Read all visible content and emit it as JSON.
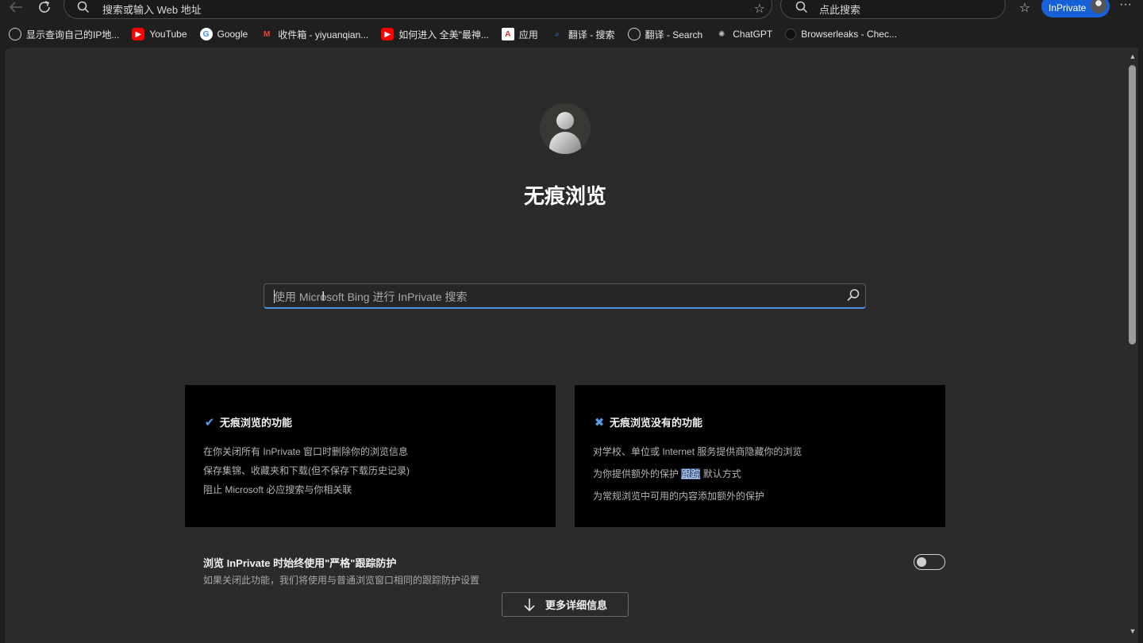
{
  "toolbar": {
    "address_text": "搜索或输入 Web 地址",
    "search_text": "点此搜索",
    "inprivate_label": "InPrivate"
  },
  "bookmarks": [
    {
      "label": "显示查询自己的IP地...",
      "icon": "globe-icon"
    },
    {
      "label": "YouTube",
      "icon": "youtube-icon"
    },
    {
      "label": "Google",
      "icon": "google-icon"
    },
    {
      "label": "收件箱 - yiyuanqian...",
      "icon": "gmail-icon"
    },
    {
      "label": "如何进入 全美\"最神...",
      "icon": "youtube-icon"
    },
    {
      "label": "应用",
      "icon": "apps-icon"
    },
    {
      "label": "翻译 - 搜索",
      "icon": "bing-icon"
    },
    {
      "label": "翻译 - Search",
      "icon": "globe-icon"
    },
    {
      "label": "ChatGPT",
      "icon": "chatgpt-icon"
    },
    {
      "label": "Browserleaks - Chec...",
      "icon": "browserleaks-icon"
    }
  ],
  "main": {
    "title": "无痕浏览",
    "search_placeholder": "使用 Microsoft Bing 进行 InPrivate 搜索"
  },
  "card_does": {
    "heading": "无痕浏览的功能",
    "items": [
      "在你关闭所有 InPrivate 窗口时删除你的浏览信息",
      "保存集锦、收藏夹和下载(但不保存下载历史记录)",
      "阻止 Microsoft 必应搜索与你相关联"
    ]
  },
  "card_doesnt": {
    "heading": "无痕浏览没有的功能",
    "item1": "对学校、单位或 Internet 服务提供商隐藏你的浏览",
    "item2_prefix": "为你提供额外的保护",
    "item2_link": "跟踪",
    "item2_suffix": "默认方式",
    "item3": "为常规浏览中可用的内容添加额外的保护"
  },
  "tracking": {
    "title": "浏览 InPrivate 时始终使用\"严格\"跟踪防护",
    "description": "如果关闭此功能，我们将使用与普通浏览窗口相同的跟踪防护设置",
    "enabled": false
  },
  "more_info_label": "更多详细信息",
  "colors": {
    "accent": "#1860d8",
    "link": "#6ea2e8",
    "page_bg": "#2b2b2b",
    "card_bg": "#000000"
  }
}
